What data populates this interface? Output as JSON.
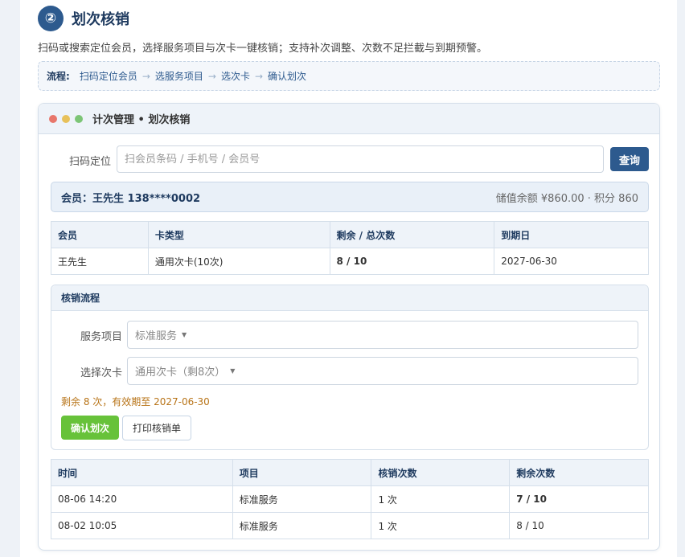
{
  "step": {
    "number": "②",
    "title": "划次核销",
    "description": "扫码或搜索定位会员，选择服务项目与次卡一键核销；支持补次调整、次数不足拦截与到期预警。"
  },
  "flow": {
    "label": "流程:",
    "steps": [
      "扫码定位会员",
      "选服务项目",
      "选次卡",
      "确认划次"
    ],
    "arrow": "→"
  },
  "window": {
    "title": "计次管理 • 划次核销",
    "dot_colors": [
      "#e8766b",
      "#e8c15a",
      "#7cc576"
    ]
  },
  "scan": {
    "label": "扫码定位",
    "placeholder": "扫会员条码 / 手机号 / 会员号",
    "button": "查询"
  },
  "member": {
    "name": "会员：王先生 138****0002",
    "balance": "储值余额 ¥860.00 · 积分 860"
  },
  "card_table": {
    "headers": [
      "会员",
      "卡类型",
      "剩余 / 总次数",
      "到期日"
    ],
    "rows": [
      [
        "王先生",
        "通用次卡(10次)",
        "8 / 10",
        "2027-06-30"
      ]
    ]
  },
  "verify": {
    "title": "核销流程",
    "service_label": "服务项目",
    "service_value": "标准服务",
    "card_label": "选择次卡",
    "card_value": "通用次卡（剩8次）",
    "caret": "▼",
    "hint": "剩余 8 次，有效期至 2027-06-30",
    "confirm_button": "确认划次",
    "print_button": "打印核销单"
  },
  "log_table": {
    "headers": [
      "时间",
      "项目",
      "核销次数",
      "剩余次数"
    ],
    "rows": [
      [
        "08-06 14:20",
        "标准服务",
        "1 次",
        "7 / 10"
      ],
      [
        "08-02 10:05",
        "标准服务",
        "1 次",
        "8 / 10"
      ]
    ]
  },
  "colors": {
    "primary": "#2d5a8e",
    "confirm": "#67c23a",
    "hint": "#b87418"
  }
}
